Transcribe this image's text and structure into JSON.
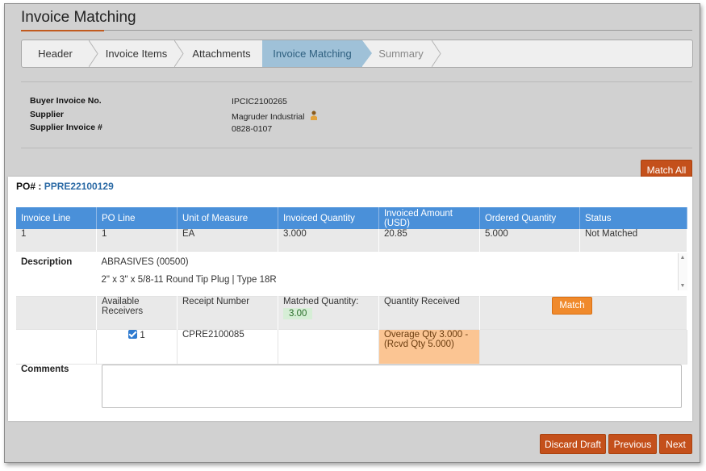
{
  "page": {
    "title": "Invoice Matching"
  },
  "wizard": {
    "steps": [
      {
        "label": "Header",
        "state": "done"
      },
      {
        "label": "Invoice Items",
        "state": "done"
      },
      {
        "label": "Attachments",
        "state": "done"
      },
      {
        "label": "Invoice Matching",
        "state": "active"
      },
      {
        "label": "Summary",
        "state": "future"
      }
    ]
  },
  "invoice_info": {
    "buyer_invoice_label": "Buyer Invoice No.",
    "buyer_invoice_value": "IPCIC2100265",
    "supplier_label": "Supplier",
    "supplier_value": "Magruder Industrial",
    "supplier_invoice_label": "Supplier Invoice #",
    "supplier_invoice_value": "0828-0107"
  },
  "actions": {
    "match_all": "Match All",
    "discard_draft": "Discard Draft",
    "previous": "Previous",
    "next": "Next"
  },
  "po": {
    "label": "PO# :",
    "number": "PPRE22100129",
    "columns": [
      "Invoice Line",
      "PO Line",
      "Unit of Measure",
      "Invoiced Quantity",
      "Invoiced Amount (USD)",
      "Ordered Quantity",
      "Status"
    ],
    "line": {
      "invoice_line": "1",
      "po_line": "1",
      "uom": "EA",
      "invoiced_qty": "3.000",
      "invoiced_amount": "20.85",
      "ordered_qty": "5.000",
      "status": "Not Matched"
    },
    "description_label": "Description",
    "description_code": "ABRASIVES (00500)",
    "description_text": "2\" x 3\" x 5/8-11 Round Tip Plug | Type 18R",
    "receivers": {
      "available_label": "Available Receivers",
      "receipt_label": "Receipt Number",
      "matched_label": "Matched Quantity:",
      "matched_value": "3.00",
      "received_label": "Quantity Received",
      "match_button": "Match",
      "row": {
        "receiver_no": "1",
        "receipt_number": "CPRE2100085",
        "overage_text": "Overage Qty 3.000 - (Rcvd Qty 5.000)"
      }
    },
    "comments_label": "Comments"
  },
  "colors": {
    "accent": "#c4501b",
    "header_blue": "#4a90d9",
    "active_step": "#9fc1d8",
    "overage": "#fbc593"
  }
}
